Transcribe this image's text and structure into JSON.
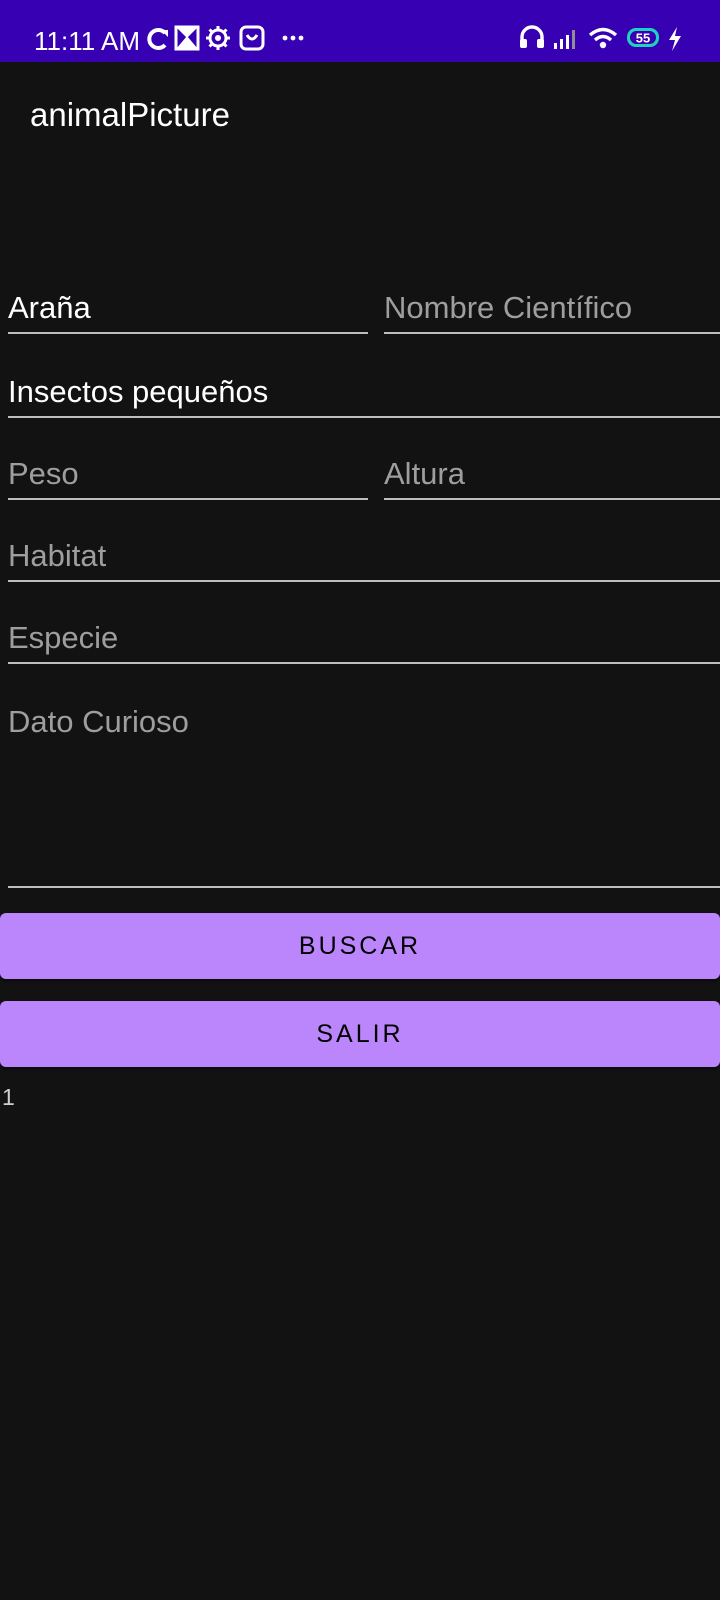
{
  "status_bar": {
    "time": "11:11 AM",
    "battery_level": "55",
    "icons": [
      "sync-icon",
      "photo-download-icon",
      "settings-gear-icon",
      "shopping-bag-icon",
      "more-dots-icon",
      "headset-icon",
      "signal-icon",
      "wifi-icon",
      "battery-icon",
      "charging-bolt-icon"
    ],
    "background_color": "#3700b3"
  },
  "app_bar": {
    "title": "animalPicture"
  },
  "form": {
    "name": {
      "value": "Araña",
      "placeholder": ""
    },
    "scientific_name": {
      "value": "",
      "placeholder": "Nombre Científico"
    },
    "diet": {
      "value": "Insectos pequeños",
      "placeholder": ""
    },
    "weight": {
      "value": "",
      "placeholder": "Peso"
    },
    "height": {
      "value": "",
      "placeholder": "Altura"
    },
    "habitat": {
      "value": "",
      "placeholder": "Habitat"
    },
    "species": {
      "value": "",
      "placeholder": "Especie"
    },
    "fun_fact": {
      "value": "",
      "placeholder": "Dato Curioso"
    }
  },
  "buttons": {
    "search": "BUSCAR",
    "exit": "SALIR"
  },
  "counter": "1",
  "colors": {
    "background": "#121212",
    "button": "#bb86fc",
    "field_underline": "#bdbdbd",
    "placeholder": "#9e9e9e"
  }
}
